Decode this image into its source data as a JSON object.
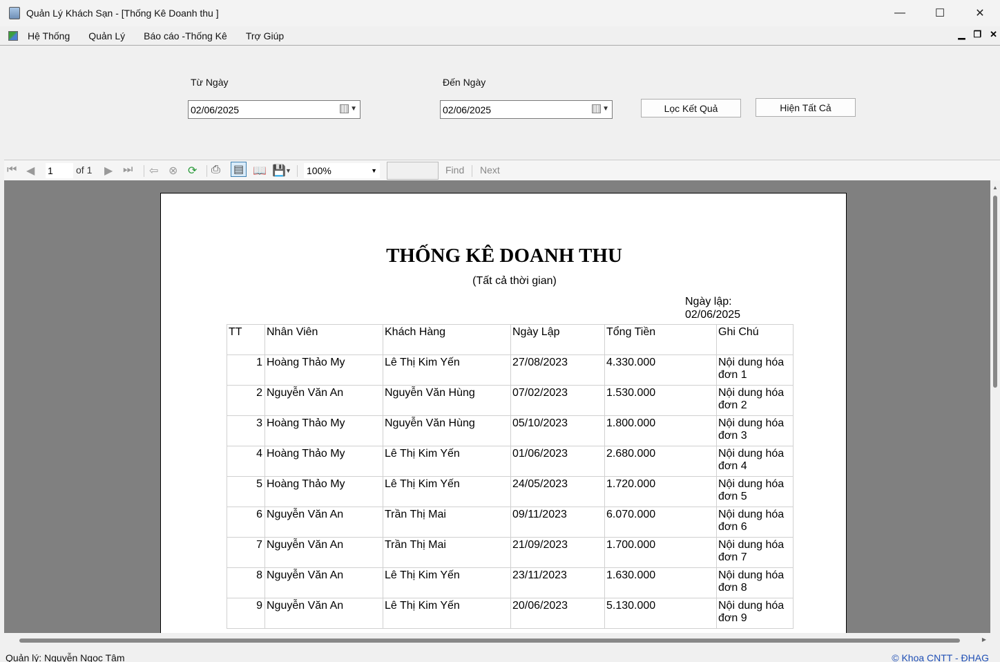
{
  "window": {
    "title": "Quản Lý Khách Sạn  - [Thống Kê Doanh thu ]",
    "minimize": "—",
    "maximize": "☐",
    "close": "✕"
  },
  "menu": {
    "items": [
      "Hệ Thống",
      "Quản Lý",
      "Báo cáo -Thống Kê",
      "Trợ Giúp"
    ],
    "mdi_min": "▁",
    "mdi_restore": "❐",
    "mdi_close": "✕"
  },
  "filter": {
    "from_label": "Từ Ngày",
    "from_value": "02/06/2025",
    "to_label": "Đến Ngày",
    "to_value": "02/06/2025",
    "filter_button": "Lọc Kết Quả",
    "show_all_button": "Hiện Tất Cả"
  },
  "toolbar": {
    "page_current": "1",
    "page_of": "of  1",
    "zoom": "100%",
    "find_label": "Find",
    "next_label": "Next"
  },
  "report": {
    "title": "THỐNG KÊ DOANH THU",
    "subtitle": "(Tất cả thời gian)",
    "date_label": "Ngày lập:",
    "date_value": "02/06/2025",
    "columns": [
      "TT",
      "Nhân Viên",
      "Khách Hàng",
      "Ngày Lập",
      "Tổng Tiền",
      "Ghi Chú"
    ],
    "rows": [
      {
        "tt": "1",
        "nhan_vien": "Hoàng Thảo My",
        "khach_hang": "Lê Thị Kim Yến",
        "ngay_lap": "27/08/2023",
        "tong_tien": "4.330.000",
        "ghi_chu": "Nội dung hóa đơn 1"
      },
      {
        "tt": "2",
        "nhan_vien": "Nguyễn Văn An",
        "khach_hang": "Nguyễn Văn Hùng",
        "ngay_lap": "07/02/2023",
        "tong_tien": "1.530.000",
        "ghi_chu": "Nội dung hóa đơn 2"
      },
      {
        "tt": "3",
        "nhan_vien": "Hoàng Thảo My",
        "khach_hang": "Nguyễn Văn Hùng",
        "ngay_lap": "05/10/2023",
        "tong_tien": "1.800.000",
        "ghi_chu": "Nội dung hóa đơn 3"
      },
      {
        "tt": "4",
        "nhan_vien": "Hoàng Thảo My",
        "khach_hang": "Lê Thị Kim Yến",
        "ngay_lap": "01/06/2023",
        "tong_tien": "2.680.000",
        "ghi_chu": "Nội dung hóa đơn 4"
      },
      {
        "tt": "5",
        "nhan_vien": "Hoàng Thảo My",
        "khach_hang": "Lê Thị Kim Yến",
        "ngay_lap": "24/05/2023",
        "tong_tien": "1.720.000",
        "ghi_chu": "Nội dung hóa đơn 5"
      },
      {
        "tt": "6",
        "nhan_vien": "Nguyễn Văn An",
        "khach_hang": "Trần Thị Mai",
        "ngay_lap": "09/11/2023",
        "tong_tien": "6.070.000",
        "ghi_chu": "Nội dung hóa đơn 6"
      },
      {
        "tt": "7",
        "nhan_vien": "Nguyễn Văn An",
        "khach_hang": "Trần Thị Mai",
        "ngay_lap": "21/09/2023",
        "tong_tien": "1.700.000",
        "ghi_chu": "Nội dung hóa đơn 7"
      },
      {
        "tt": "8",
        "nhan_vien": "Nguyễn Văn An",
        "khach_hang": "Lê Thị Kim Yến",
        "ngay_lap": "23/11/2023",
        "tong_tien": "1.630.000",
        "ghi_chu": "Nội dung hóa đơn 8"
      },
      {
        "tt": "9",
        "nhan_vien": "Nguyễn Văn An",
        "khach_hang": "Lê Thị Kim Yến",
        "ngay_lap": "20/06/2023",
        "tong_tien": "5.130.000",
        "ghi_chu": "Nội dung hóa đơn 9"
      }
    ]
  },
  "status": {
    "left": "Quản lý: Nguyễn Ngọc Tâm",
    "right": "© Khoa CNTT - ĐHAG"
  }
}
